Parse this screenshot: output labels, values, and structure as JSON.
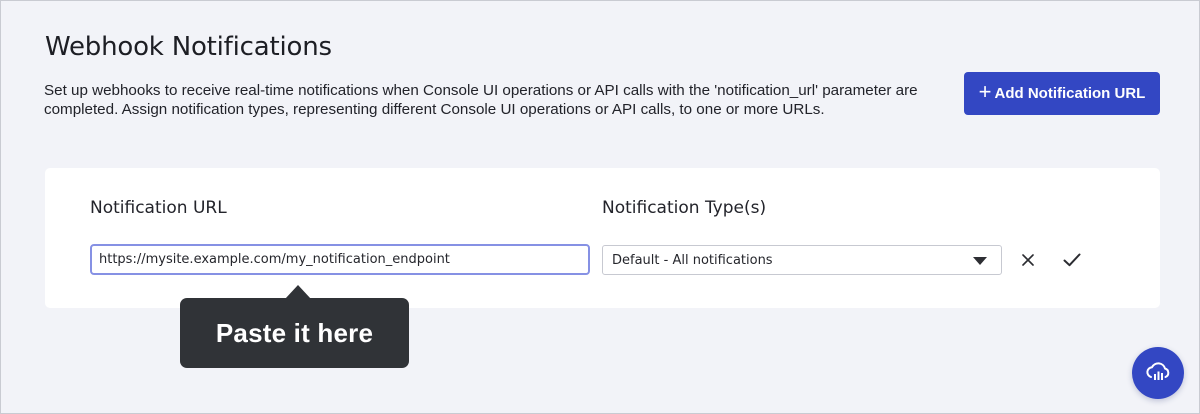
{
  "header": {
    "title": "Webhook Notifications",
    "description": "Set up webhooks to receive real-time notifications when Console UI operations or API calls with the 'notification_url' parameter are completed. Assign notification types, representing different Console UI operations or API calls, to one or more URLs."
  },
  "add_button": {
    "icon": "plus-icon",
    "label": "Add Notification URL"
  },
  "form": {
    "url_label": "Notification URL",
    "type_label": "Notification Type(s)",
    "url_value": "https://mysite.example.com/my_notification_endpoint",
    "type_value": "Default - All notifications",
    "cancel_icon": "close-icon",
    "confirm_icon": "check-icon"
  },
  "tooltip": {
    "text": "Paste it here"
  },
  "fab": {
    "icon": "cloud-chart-icon"
  },
  "colors": {
    "accent": "#3347c3",
    "background": "#f2f3f8",
    "tooltip": "#303337"
  }
}
